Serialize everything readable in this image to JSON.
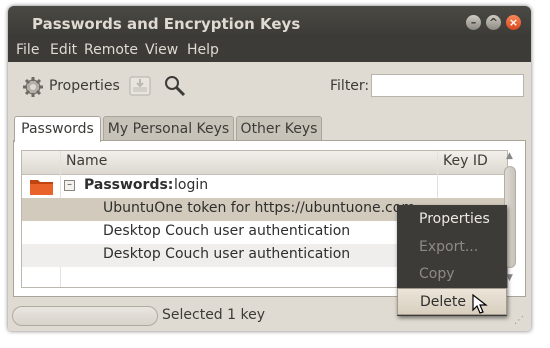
{
  "window": {
    "title": "Passwords and Encryption Keys",
    "controls": {
      "minimize": "–",
      "maximize": "^",
      "close": "×"
    }
  },
  "menu": [
    "File",
    "Edit",
    "Remote",
    "View",
    "Help"
  ],
  "toolbar": {
    "properties_label": "Properties",
    "import_icon": "import-icon",
    "search_icon": "search-icon",
    "filter_label": "Filter:",
    "filter_value": ""
  },
  "tabs": [
    {
      "label": "Passwords",
      "active": true
    },
    {
      "label": "My Personal Keys",
      "active": false
    },
    {
      "label": "Other Keys",
      "active": false
    }
  ],
  "columns": {
    "name": "Name",
    "key_id": "Key ID"
  },
  "keyring": {
    "expander": "–",
    "bold_label": "Passwords:",
    "name": "login"
  },
  "items": [
    {
      "name": "UbuntuOne token for https://ubuntuone.com",
      "selected": true
    },
    {
      "name": "Desktop Couch user authentication",
      "selected": false
    },
    {
      "name": "Desktop Couch user authentication",
      "selected": false
    }
  ],
  "status": {
    "text": "Selected 1 key"
  },
  "context_menu": {
    "items": [
      {
        "label": "Properties",
        "enabled": true
      },
      {
        "label": "Export...",
        "enabled": false
      },
      {
        "label": "Copy",
        "enabled": false
      },
      {
        "label": "Delete",
        "enabled": true,
        "hovered": true
      }
    ]
  },
  "colors": {
    "titlebar": "#3c3b37",
    "selection": "#d2cbbd",
    "menu_bg": "#3c3b37",
    "menu_hover": "#e4dcd0"
  }
}
